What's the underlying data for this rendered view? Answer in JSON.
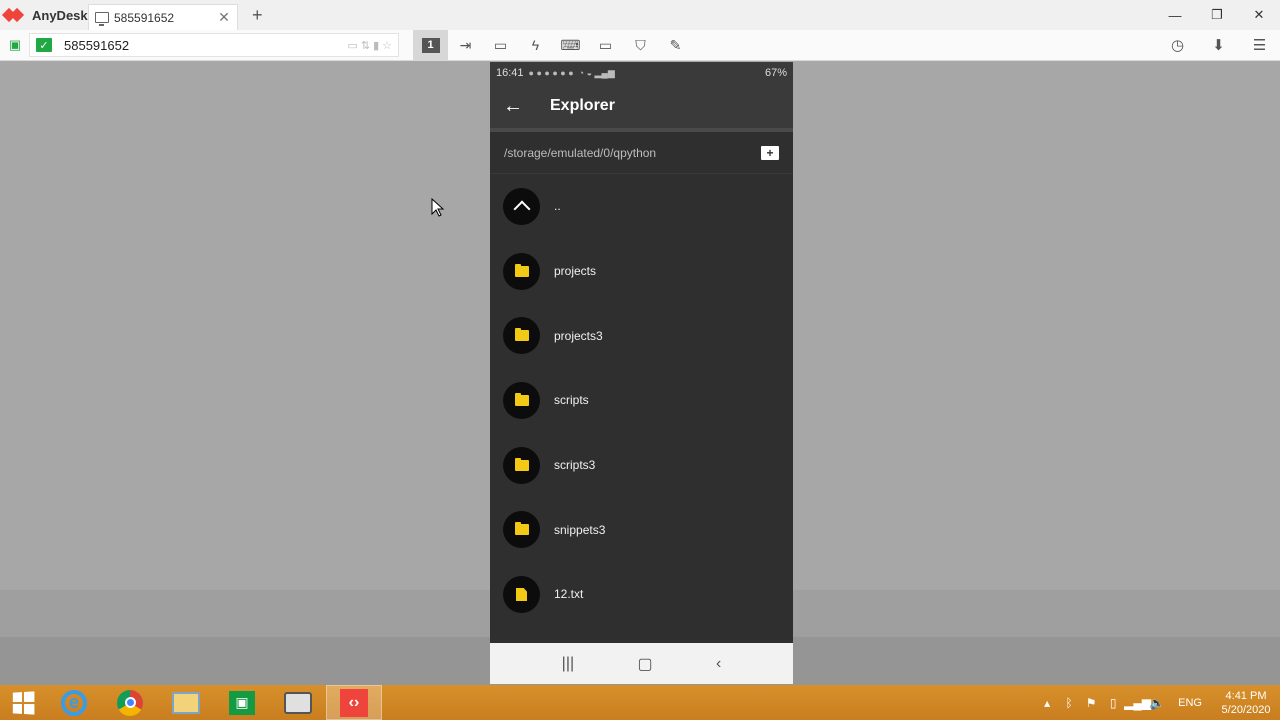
{
  "app": {
    "name": "AnyDesk"
  },
  "tab": {
    "label": "585591652"
  },
  "address": {
    "value": "585591652"
  },
  "toolbar": {
    "display_button": "1"
  },
  "phone": {
    "status": {
      "time": "16:41",
      "battery": "67%"
    },
    "title": "Explorer",
    "path": "/storage/emulated/0/qpython",
    "items": [
      {
        "label": "..",
        "type": "parent"
      },
      {
        "label": "projects",
        "type": "folder"
      },
      {
        "label": "projects3",
        "type": "folder"
      },
      {
        "label": "scripts",
        "type": "folder"
      },
      {
        "label": "scripts3",
        "type": "folder"
      },
      {
        "label": "snippets3",
        "type": "folder"
      },
      {
        "label": "12.txt",
        "type": "file"
      }
    ]
  },
  "taskbar": {
    "lang": "ENG",
    "time": "4:41 PM",
    "date": "5/20/2020"
  }
}
